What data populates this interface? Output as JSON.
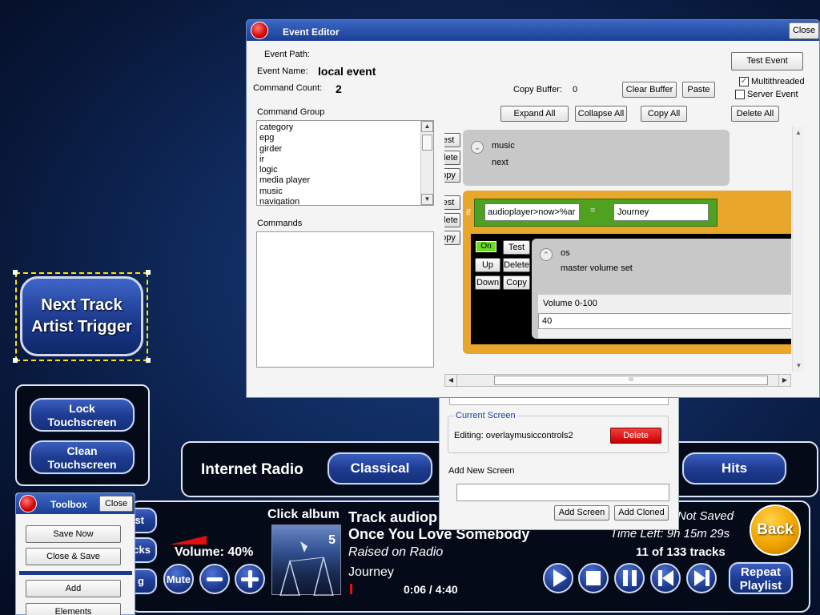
{
  "trigger_button": {
    "line1": "Next Track",
    "line2": "Artist Trigger"
  },
  "touch_panel": {
    "lock_line1": "Lock",
    "lock_line2": "Touchscreen",
    "clean_line1": "Clean",
    "clean_line2": "Touchscreen"
  },
  "radio_bar": {
    "label": "Internet Radio",
    "classical": "Classical",
    "hits": "Hits"
  },
  "player": {
    "click_album": "Click album",
    "track_line": "Track audiop",
    "title": "Once You Love Somebody",
    "album": "Raised on Radio",
    "artist": "Journey",
    "time": "0:06 / 4:40",
    "volume": "Volume: 40%",
    "mute": "Mute",
    "not_saved": "Not Saved",
    "time_left": "Time Left: 9h 15m 29s",
    "tracks": "11 of 133 tracks",
    "back": "Back",
    "repeat_line1": "Repeat",
    "repeat_line2": "Playlist",
    "album_badge": "5",
    "partial_st": "st",
    "partial_cks": "cks",
    "partial_g": "g"
  },
  "toolbox": {
    "title": "Toolbox",
    "close": "Close",
    "save_now": "Save Now",
    "close_save": "Close & Save",
    "add": "Add",
    "elements": "Elements"
  },
  "screen_panel": {
    "current_screen_label": "Current Screen",
    "editing": "Editing: overlaymusiccontrols2",
    "delete": "Delete",
    "add_new_label": "Add New Screen",
    "add_new_value": "",
    "add_screen": "Add Screen",
    "add_cloned": "Add Cloned"
  },
  "event_editor": {
    "title": "Event Editor",
    "close": "Close",
    "event_path_label": "Event Path:",
    "event_name_label": "Event Name:",
    "event_name": "local event",
    "command_count_label": "Command Count:",
    "command_count": "2",
    "copy_buffer_label": "Copy Buffer:",
    "copy_buffer": "0",
    "clear_buffer": "Clear Buffer",
    "paste": "Paste",
    "test_event": "Test Event",
    "multithreaded": "Multithreaded",
    "server_event": "Server Event",
    "expand_all": "Expand All",
    "collapse_all": "Collapse All",
    "copy_all": "Copy All",
    "delete_all": "Delete All",
    "command_group_label": "Command Group",
    "command_groups": [
      "category",
      "epg",
      "girder",
      "ir",
      "logic",
      "media player",
      "music",
      "navigation"
    ],
    "commands_label": "Commands",
    "side_test": "est",
    "side_delete": "elete",
    "side_copy": "opy",
    "cmd1_group": "music",
    "cmd1_name": "next",
    "if_label": "if",
    "cond_left": "audioplayer>now>%ar",
    "cond_op": "=",
    "cond_right": "Journey",
    "on": "On",
    "test": "Test",
    "up": "Up",
    "delete": "Delete",
    "down": "Down",
    "copy": "Copy",
    "cmd2_group": "os",
    "cmd2_name": "master volume set",
    "param_label": "Volume 0-100",
    "param_value": "40",
    "hscroll_grip": "III"
  }
}
